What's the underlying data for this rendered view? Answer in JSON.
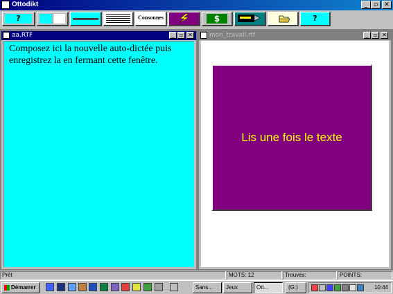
{
  "app": {
    "title": "Ottodikt"
  },
  "window_buttons": {
    "minimize": "_",
    "maximize": "▫",
    "close": "✕"
  },
  "toolbar": {
    "help_glyph": "?",
    "consonnes_label": "Consonnes",
    "dollar_glyph": "$",
    "help2_glyph": "?"
  },
  "left_window": {
    "title": "aa.RTF",
    "body_text": "Composez ici la nouvelle auto-dictée puis enregistrez la en fermant cette fenêtre."
  },
  "right_window": {
    "title": "mon_travail.rtf",
    "button_label": "Lis une fois le texte"
  },
  "statusbar": {
    "status": "Prêt",
    "mots": "MOTS: 12",
    "trouves": "Trouvés:",
    "points": "POINTS:"
  },
  "taskbar": {
    "start_label": "Démarrer",
    "tasks": [
      "Sans...",
      "Jeux",
      "Ott..."
    ],
    "drive": "(G:)",
    "clock": "10:44"
  },
  "colors": {
    "doc_bg": "#00ffff",
    "button_bg": "#800080",
    "button_text": "#ffff00",
    "titlebar": "#000080"
  }
}
